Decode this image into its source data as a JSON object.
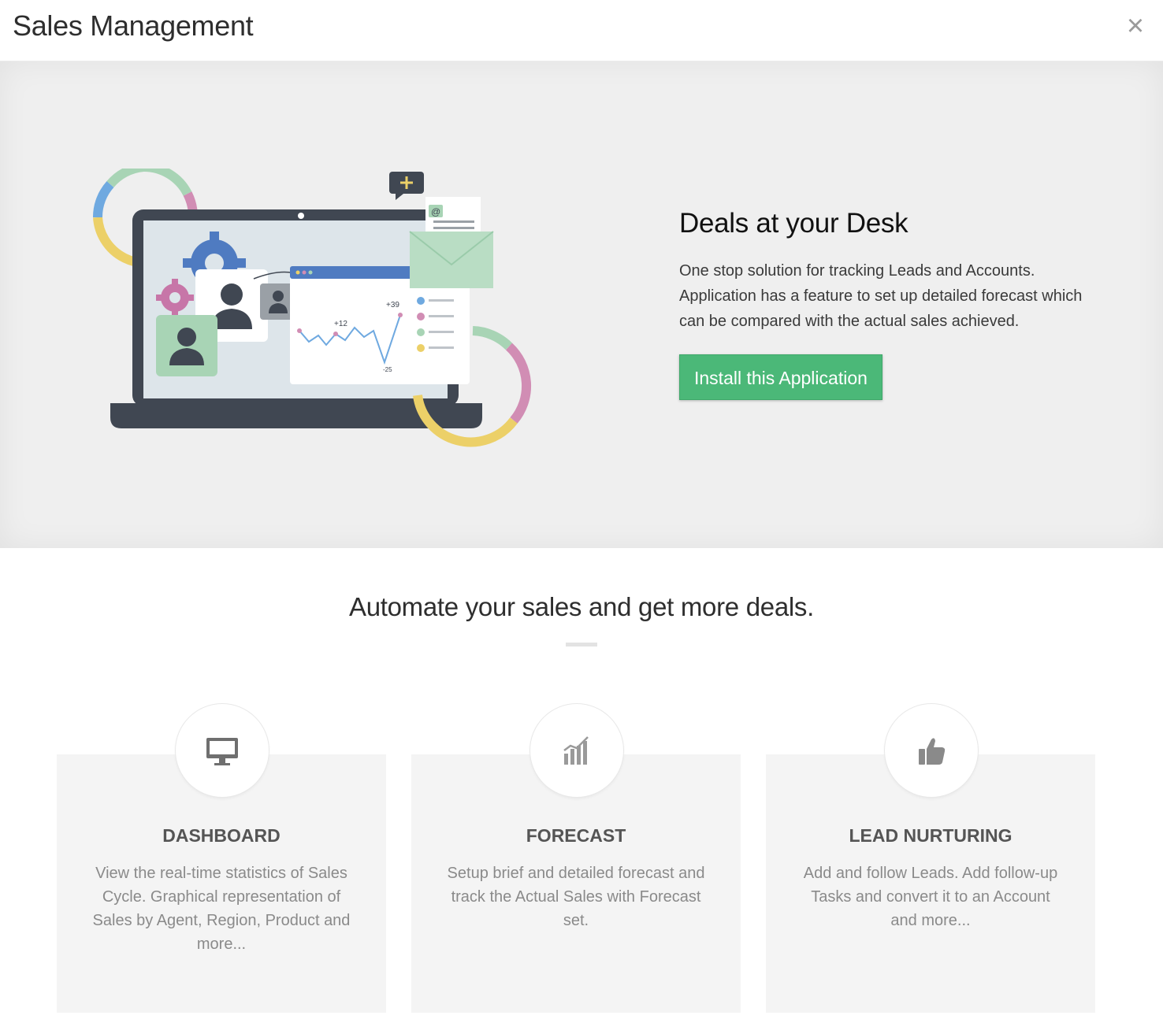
{
  "header": {
    "title": "Sales Management",
    "close_symbol": "×"
  },
  "hero": {
    "title": "Deals at your Desk",
    "description": "One stop solution for tracking Leads and Accounts. Application has a feature to set up detailed forecast which can be compared with the actual sales achieved.",
    "install_label": "Install this Application",
    "illustration": {
      "labels": [
        "+39",
        "+12",
        "-25"
      ],
      "icons": [
        "laptop",
        "pie-chart-ring",
        "gear",
        "user-avatar",
        "line-chart",
        "email-envelope",
        "chat-bubble-plus"
      ]
    }
  },
  "tagline": "Automate your sales and get more deals.",
  "features": [
    {
      "icon": "monitor-icon",
      "title": "DASHBOARD",
      "description": "View the real-time statistics of Sales Cycle. Graphical representation of Sales by Agent, Region, Product and more..."
    },
    {
      "icon": "bar-chart-icon",
      "title": "FORECAST",
      "description": "Setup brief and detailed forecast and track the Actual Sales with Forecast set."
    },
    {
      "icon": "thumbs-up-icon",
      "title": "LEAD NURTURING",
      "description": "Add and follow Leads. Add follow-up Tasks and convert it to an Account and more..."
    }
  ],
  "colors": {
    "accent_green": "#4bb878",
    "hero_background": "#efefef",
    "card_background": "#f4f4f4",
    "ring_green": "#a8d4b5",
    "ring_pink": "#d18db4",
    "ring_yellow": "#ecd068",
    "ring_blue": "#6fa9e0",
    "laptop_dark": "#404752",
    "gear_blue": "#4f7bc1",
    "gear_pink": "#c776a8"
  }
}
